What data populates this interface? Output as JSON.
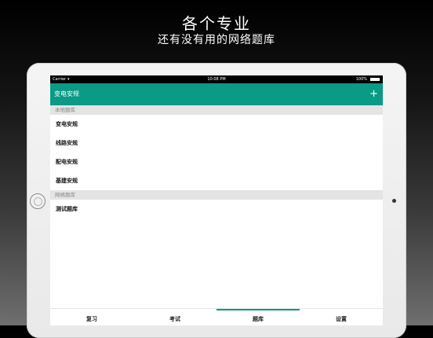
{
  "promo": {
    "title": "各个专业",
    "subtitle": "还有没有用的网络题库"
  },
  "status_bar": {
    "carrier": "Carrier",
    "time": "10:08 PM",
    "battery": "100%"
  },
  "nav": {
    "title": "变电安规",
    "add_icon": "+"
  },
  "sections": [
    {
      "header": "本地题库",
      "items": [
        "变电安规",
        "线路安规",
        "配电安规",
        "基建安规"
      ]
    },
    {
      "header": "网络题库",
      "items": [
        "测试题库"
      ]
    }
  ],
  "tabs": [
    {
      "label": "复习",
      "selected": false
    },
    {
      "label": "考试",
      "selected": false
    },
    {
      "label": "题库",
      "selected": true
    },
    {
      "label": "设置",
      "selected": false
    }
  ],
  "colors": {
    "accent": "#0a9a86",
    "section_bg": "#e4e4e4"
  }
}
